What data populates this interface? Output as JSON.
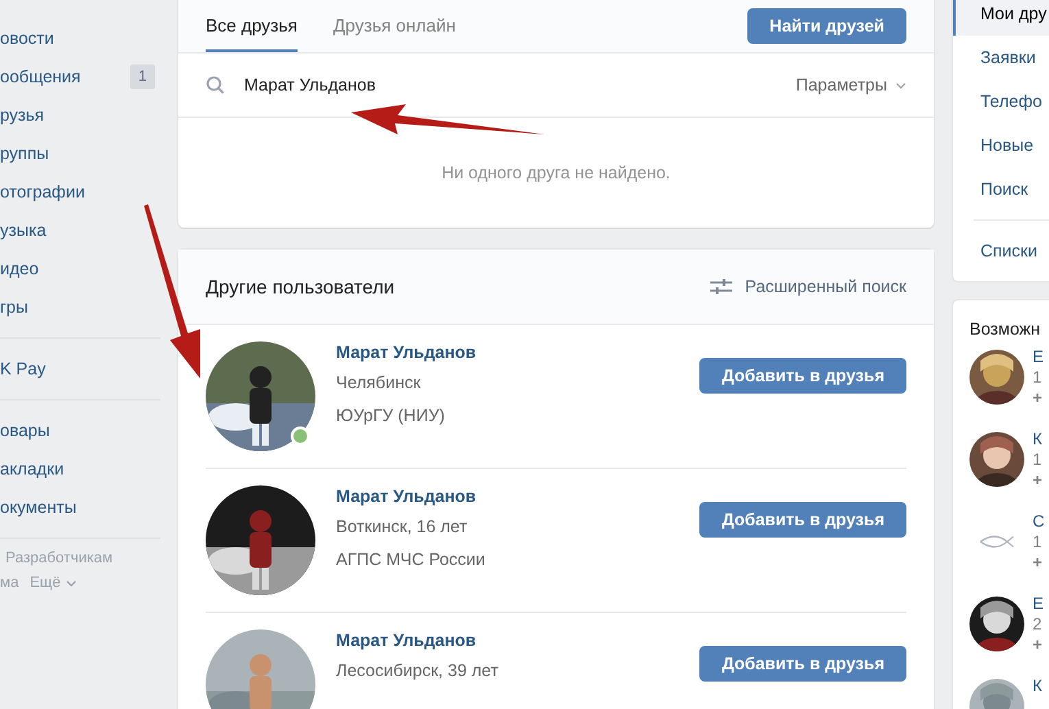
{
  "sidebar": {
    "groups": [
      [
        {
          "label": "овости"
        },
        {
          "label": "ообщения",
          "badge": "1"
        },
        {
          "label": "рузья"
        },
        {
          "label": "руппы"
        },
        {
          "label": "отографии"
        },
        {
          "label": "узыка"
        },
        {
          "label": "идео"
        },
        {
          "label": "гры"
        }
      ],
      [
        {
          "label": "K Pay"
        }
      ],
      [
        {
          "label": "овары"
        },
        {
          "label": "акладки"
        },
        {
          "label": "окументы"
        }
      ]
    ],
    "footer": {
      "links": [
        "Разработчикам"
      ],
      "more_prefix": "ма",
      "more": "Ещё"
    }
  },
  "friends": {
    "tabs": [
      {
        "label": "Все друзья",
        "selected": true
      },
      {
        "label": "Друзья онлайн",
        "selected": false
      }
    ],
    "find_button": "Найти друзей",
    "search": {
      "value": "Марат Ульданов",
      "params": "Параметры"
    },
    "empty": "Ни одного друга не найдено."
  },
  "others": {
    "title": "Другие пользователи",
    "advanced": "Расширенный поиск",
    "users": [
      {
        "name": "Марат Ульданов",
        "lines": [
          "Челябинск",
          "ЮУрГУ (НИУ)"
        ],
        "online": true,
        "button": "Добавить в друзья",
        "avatar": {
          "kind": "picture"
        }
      },
      {
        "name": "Марат Ульданов",
        "lines": [
          "Воткинск, 16 лет",
          "АГПС МЧС России"
        ],
        "online": false,
        "button": "Добавить в друзья",
        "avatar": {
          "kind": "picture"
        }
      },
      {
        "name": "Марат Ульданов",
        "lines": [
          "Лесосибирск, 39 лет"
        ],
        "online": false,
        "button": "Добавить в друзья",
        "avatar": {
          "kind": "picture"
        }
      }
    ]
  },
  "right_menu": {
    "items": [
      {
        "label": "Мои дру",
        "selected": true
      },
      {
        "label": "Заявки",
        "selected": false
      },
      {
        "label": "Телефо",
        "selected": false
      },
      {
        "label": "Новые",
        "selected": false
      },
      {
        "label": "Поиск",
        "selected": false
      }
    ],
    "lists": "Списки"
  },
  "suggestions": {
    "title": "Возможн",
    "items": [
      {
        "kind": "picture",
        "name": "Е",
        "info": "1",
        "add": "+"
      },
      {
        "kind": "picture",
        "name": "К",
        "info": "1",
        "add": "+"
      },
      {
        "kind": "fish",
        "name": "С",
        "info": "1",
        "add": "+"
      },
      {
        "kind": "picture",
        "name": "Е",
        "info": "2",
        "add": "+"
      },
      {
        "kind": "picture",
        "name": "К"
      }
    ]
  }
}
